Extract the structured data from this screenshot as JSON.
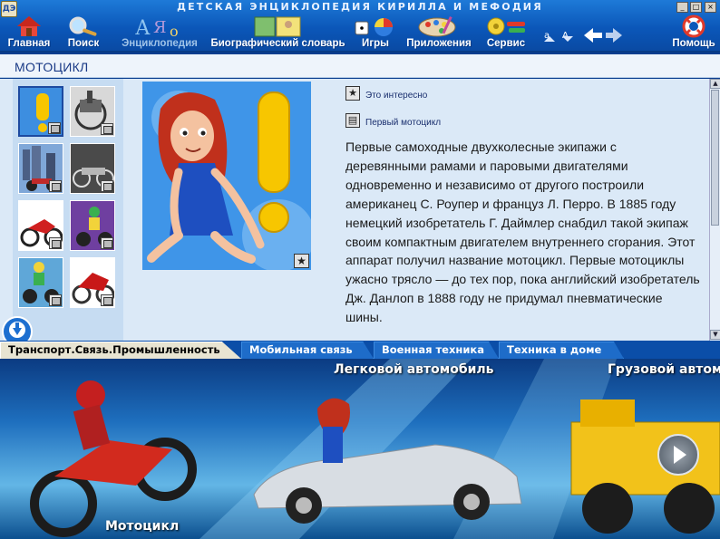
{
  "app": {
    "title": "ДЕТСКАЯ ЭНЦИКЛОПЕДИЯ КИРИЛЛА И МЕФОДИЯ",
    "logo_text": "ДЭ"
  },
  "toolbar": {
    "items": [
      {
        "label": "Главная",
        "icon": "house-icon"
      },
      {
        "label": "Поиск",
        "icon": "magnifier-icon"
      },
      {
        "label": "Энциклопедия",
        "icon": "letters-icon",
        "disabled": true
      },
      {
        "label": "Биографический словарь",
        "icon": "portrait-icon"
      },
      {
        "label": "Игры",
        "icon": "dice-icon"
      },
      {
        "label": "Приложения",
        "icon": "palette-icon"
      },
      {
        "label": "Сервис",
        "icon": "tools-icon"
      }
    ],
    "help_label": "Помощь"
  },
  "article": {
    "title": "МОТОЦИКЛ",
    "links": [
      {
        "label": "Это интересно",
        "icon": "star-icon"
      },
      {
        "label": "Первый мотоцикл",
        "icon": "picture-icon"
      }
    ],
    "body": "Первые самоходные двухколесные экипажи с деревянными рамами и паровыми двигателями одновременно и независимо от другого построили американец С. Роупер и француз Л. Перро. В 1885 году немецкий изобретатель Г. Даймлер снабдил такой экипаж своим компактным двигателем внутреннего сгорания. Этот аппарат получил название мотоцикл. Первые мотоциклы ужасно трясло — до тех пор, пока английский изобретатель Дж. Данлоп в 1888 году не придумал пневматические шины."
  },
  "tabs": [
    {
      "label": "Транспорт.Связь.Промышленность",
      "active": true
    },
    {
      "label": "Мобильная связь",
      "active": false
    },
    {
      "label": "Военная техника",
      "active": false
    },
    {
      "label": "Техника в доме",
      "active": false
    }
  ],
  "banner": {
    "items": [
      {
        "label": "Мотоцикл"
      },
      {
        "label": "Легковой автомобиль"
      },
      {
        "label": "Грузовой автомобиль"
      }
    ]
  },
  "colors": {
    "toolbar_bg": "#0b57b9",
    "content_bg": "#dbe9f7",
    "accent_yellow": "#f7c600"
  }
}
